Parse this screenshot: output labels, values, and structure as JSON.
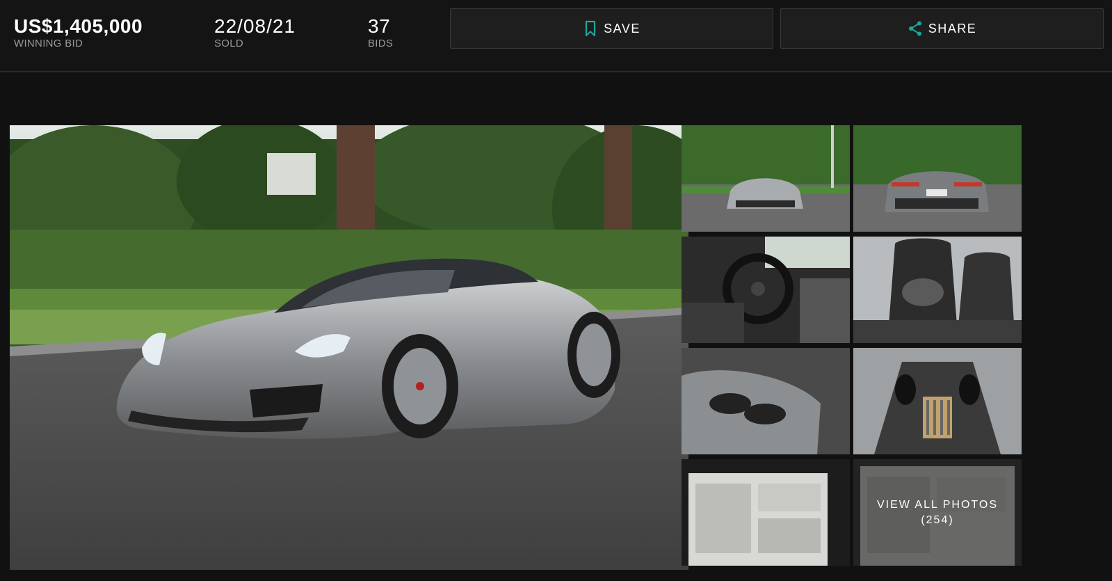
{
  "stats": {
    "winning_bid": {
      "value": "US$1,405,000",
      "label": "WINNING BID"
    },
    "sold_date": {
      "value": "22/08/21",
      "label": "SOLD"
    },
    "bids": {
      "value": "37",
      "label": "BIDS"
    }
  },
  "actions": {
    "save_label": "SAVE",
    "share_label": "SHARE",
    "accent_color": "#1fa89a"
  },
  "gallery": {
    "view_all_label": "VIEW ALL PHOTOS",
    "photo_count": "(254)"
  }
}
